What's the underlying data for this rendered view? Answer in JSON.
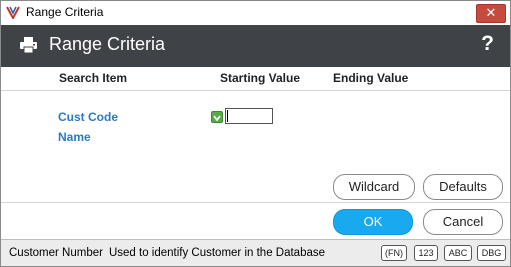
{
  "window": {
    "title": "Range Criteria",
    "close_glyph": "✕"
  },
  "header": {
    "title": "Range Criteria",
    "help_glyph": "?"
  },
  "columns": {
    "search_item": "Search Item",
    "starting_value": "Starting Value",
    "ending_value": "Ending Value"
  },
  "search_items": [
    {
      "label": "Cust Code"
    },
    {
      "label": "Name"
    }
  ],
  "fields": {
    "starting_value": ""
  },
  "buttons": {
    "wildcard": "Wildcard",
    "defaults": "Defaults",
    "ok": "OK",
    "cancel": "Cancel"
  },
  "status": {
    "field_name": "Customer Number",
    "description": "Used to identify Customer in the Database",
    "badges": [
      "(FN)",
      "123",
      "ABC",
      "DBG"
    ]
  },
  "colors": {
    "header_bg": "#3f4347",
    "link_blue": "#2a7bc4",
    "ok_blue": "#19a9ee",
    "close_red": "#c74a3f",
    "toggle_green": "#5aa94a"
  },
  "icons": {
    "app": "app-logo-icon",
    "printer": "printer-icon",
    "help": "help-icon",
    "close": "close-icon",
    "toggle": "checkbox-icon"
  }
}
